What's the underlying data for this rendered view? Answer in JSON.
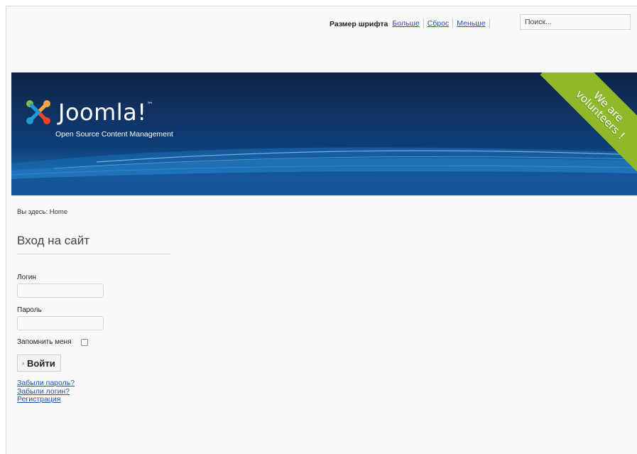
{
  "top_bar": {
    "font_size_label": "Размер шрифта",
    "font_links": [
      "Больше",
      "Сброс",
      "Меньше"
    ],
    "search_placeholder": "Поиск..."
  },
  "header": {
    "logo_text": "Joomla!",
    "logo_tm": "™",
    "tagline": "Open Source Content Management",
    "ribbon_line1": "We are",
    "ribbon_line2": "volunteers !",
    "colors": {
      "header_dark": "#0c2144",
      "header_light": "#1561a7",
      "ribbon": "#8fb82a"
    }
  },
  "breadcrumb": "Вы здесь: Home",
  "login_module": {
    "title": "Вход на сайт",
    "username_label": "Логин",
    "password_label": "Пароль",
    "remember_label": "Запомнить меня",
    "remember_checked": false,
    "submit_label": "Войти",
    "links": [
      "Забыли пароль?",
      "Забыли логин?",
      "Регистрация"
    ]
  },
  "colors": {
    "link": "#1b57b1",
    "page_bg": "#f9f9f9"
  }
}
